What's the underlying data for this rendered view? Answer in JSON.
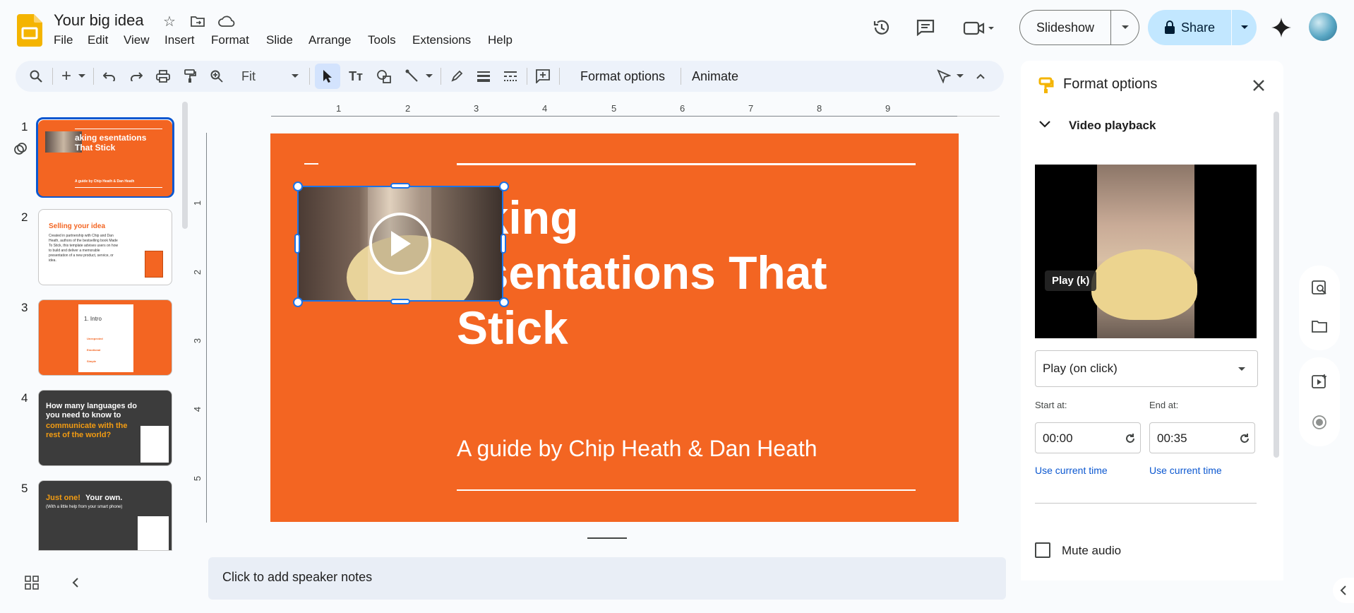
{
  "app": {
    "title": "Your big idea",
    "menu": [
      "File",
      "Edit",
      "View",
      "Insert",
      "Format",
      "Slide",
      "Arrange",
      "Tools",
      "Extensions",
      "Help"
    ],
    "slideshow_label": "Slideshow",
    "share_label": "Share"
  },
  "toolbar": {
    "zoom": "Fit",
    "format_options": "Format options",
    "animate": "Animate"
  },
  "ruler": {
    "h_ticks": [
      "1",
      "2",
      "3",
      "4",
      "5",
      "6",
      "7",
      "8",
      "9"
    ],
    "v_ticks": [
      "1",
      "2",
      "3",
      "4",
      "5"
    ]
  },
  "slide": {
    "title_lines": [
      "aking",
      "esentations That",
      "Stick"
    ],
    "subtitle": "A guide by Chip Heath & Dan Heath"
  },
  "thumbnails": [
    {
      "num": "1",
      "title": "aking esentations That Stick",
      "sub": "A guide by Chip Heath & Dan Heath"
    },
    {
      "num": "2",
      "title": "Selling your idea",
      "body": "Created in partnership with Chip and Dan Heath, authors of the bestselling book Made To Stick, this template advises users on how to build and deliver a memorable presentation of a new product, service, or idea."
    },
    {
      "num": "3",
      "title": "1. Intro",
      "items": [
        "Unexpected",
        "Emotional",
        "Simple"
      ]
    },
    {
      "num": "4",
      "title_a": "How many languages do you need to know to",
      "title_b": "communicate with the rest of the world?"
    },
    {
      "num": "5",
      "title_a": "Just one!",
      "title_b": "Your own.",
      "sub": "(With a little help from your smart phone)"
    }
  ],
  "notes": {
    "placeholder": "Click to add speaker notes"
  },
  "panel": {
    "title": "Format options",
    "section": "Video playback",
    "tooltip": "Play (k)",
    "play_mode": "Play (on click)",
    "start_label": "Start at:",
    "start_value": "00:00",
    "end_label": "End at:",
    "end_value": "00:35",
    "use_current": "Use current time",
    "mute": "Mute audio"
  },
  "colors": {
    "accent": "#f36522",
    "brand_yellow": "#f4b400",
    "share_bg": "#c2e7ff",
    "dark_slide": "#3c3c3c"
  }
}
